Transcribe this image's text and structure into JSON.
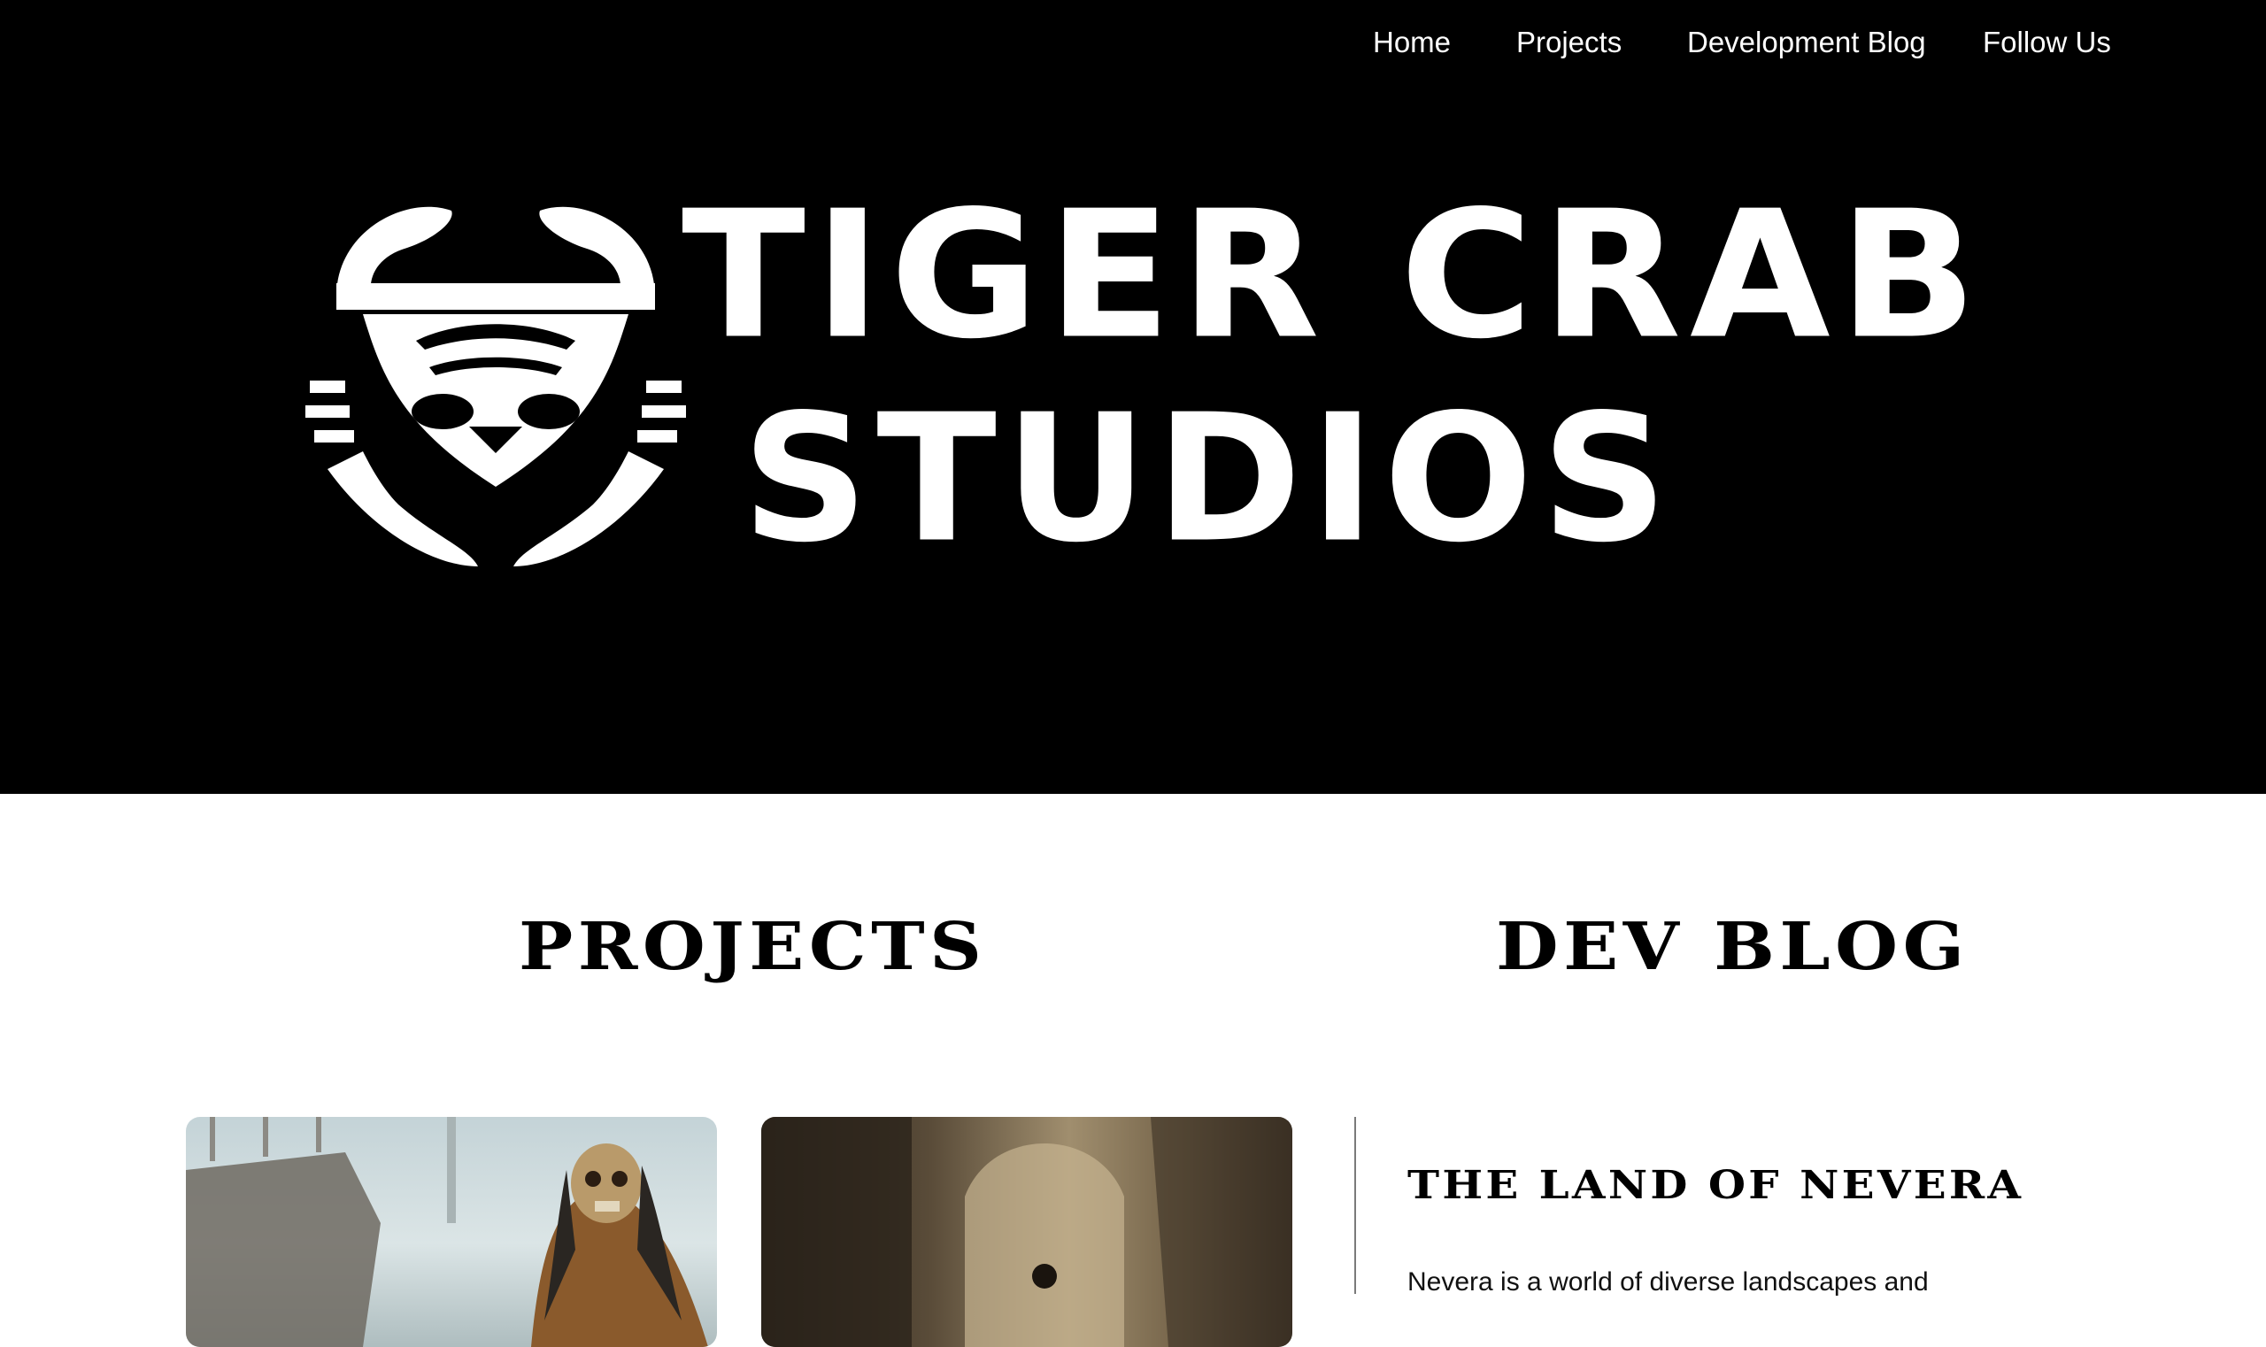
{
  "nav": {
    "items": [
      {
        "label": "Home"
      },
      {
        "label": "Projects"
      },
      {
        "label": "Development Blog"
      },
      {
        "label": "Follow Us"
      }
    ]
  },
  "logo": {
    "line1": "TIGER CRAB",
    "line2": "STUDIOS",
    "icon": "tiger-crab-icon"
  },
  "sections": {
    "projects_title": "PROJECTS",
    "devblog_title": "DEV BLOG"
  },
  "blog": {
    "post_title": "THE LAND OF NEVERA",
    "excerpt": "Nevera is a world of diverse landscapes and"
  },
  "colors": {
    "header_bg": "#000000",
    "page_bg": "#ffffff",
    "text": "#000000"
  }
}
